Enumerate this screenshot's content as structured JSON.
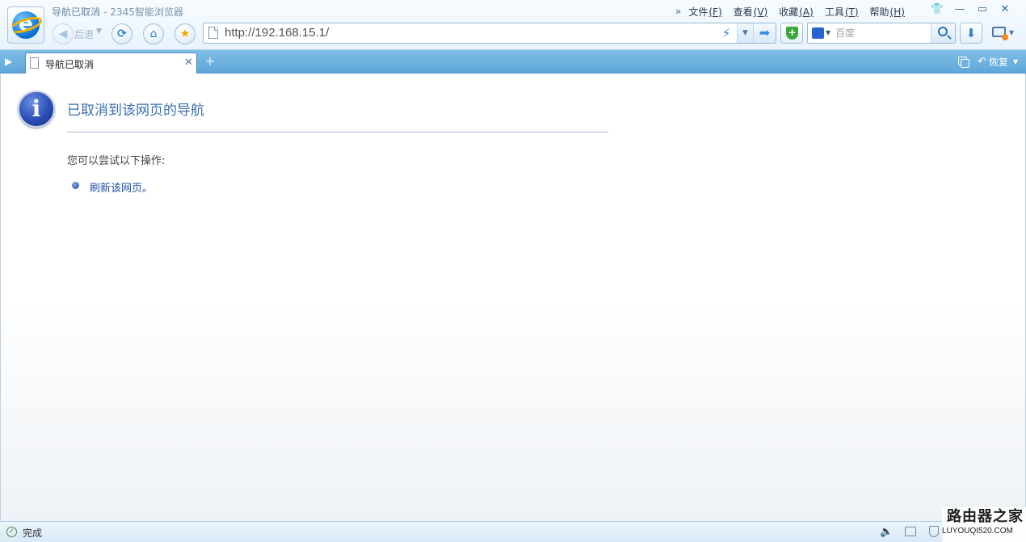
{
  "window": {
    "title": "导航已取消",
    "separator": "-",
    "app_name": "2345智能浏览器"
  },
  "menu": {
    "items": [
      {
        "label": "文件",
        "key": "(F)"
      },
      {
        "label": "查看",
        "key": "(V)"
      },
      {
        "label": "收藏",
        "key": "(A)"
      },
      {
        "label": "工具",
        "key": "(T)"
      },
      {
        "label": "帮助",
        "key": "(H)"
      }
    ]
  },
  "toolbar": {
    "back_label": "后退",
    "address_url": "http://192.168.15.1/",
    "search_placeholder": "百度"
  },
  "tabs": {
    "active_title": "导航已取消",
    "restore_label": "恢复"
  },
  "page": {
    "error_title": "已取消到该网页的导航",
    "suggestion_heading": "您可以尝试以下操作:",
    "refresh_link": "刷新该网页。"
  },
  "status": {
    "text": "完成"
  },
  "watermark": {
    "name": "路由器之家",
    "url": "LUYOUQI520.COM"
  },
  "icons": {
    "logo": "ie-logo-icon",
    "info": "info-icon",
    "security": "shield-icon",
    "download": "download-icon"
  }
}
